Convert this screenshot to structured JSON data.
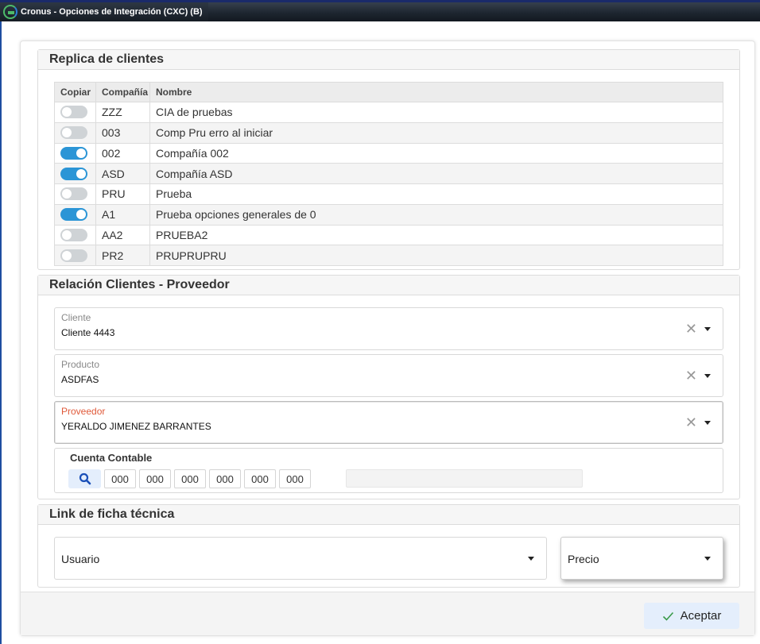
{
  "window": {
    "title": "Cronus - Opciones de Integración (CXC) (B)"
  },
  "replica": {
    "title": "Replica de clientes",
    "columns": {
      "copiar": "Copiar",
      "compania": "Compañía",
      "nombre": "Nombre"
    },
    "rows": [
      {
        "on": false,
        "code": "ZZZ",
        "name": "CIA de pruebas"
      },
      {
        "on": false,
        "code": "003",
        "name": "Comp Pru erro al iniciar"
      },
      {
        "on": true,
        "code": "002",
        "name": "Compañía 002"
      },
      {
        "on": true,
        "code": "ASD",
        "name": "Compañía ASD"
      },
      {
        "on": false,
        "code": "PRU",
        "name": "Prueba"
      },
      {
        "on": true,
        "code": "A1",
        "name": "Prueba opciones generales de 0"
      },
      {
        "on": false,
        "code": "AA2",
        "name": "PRUEBA2"
      },
      {
        "on": false,
        "code": "PR2",
        "name": "PRUPRUPRU"
      }
    ]
  },
  "relacion": {
    "title": "Relación Clientes - Proveedor",
    "cliente": {
      "label": "Cliente",
      "value": "Cliente 4443"
    },
    "producto": {
      "label": "Producto",
      "value": "ASDFAS"
    },
    "proveedor": {
      "label": "Proveedor",
      "value": "YERALDO JIMENEZ BARRANTES"
    },
    "cuenta": {
      "title": "Cuenta Contable",
      "segments": [
        "000",
        "000",
        "000",
        "000",
        "000",
        "000"
      ],
      "description": ""
    }
  },
  "link": {
    "title": "Link de ficha técnica",
    "usuario": "Usuario",
    "precio": "Precio"
  },
  "footer": {
    "accept": "Aceptar"
  },
  "colors": {
    "toggle_on": "#2b95d6",
    "toggle_off": "#cfd3d6",
    "required_label": "#e05a3a",
    "accept_bg": "#e4eefc"
  }
}
